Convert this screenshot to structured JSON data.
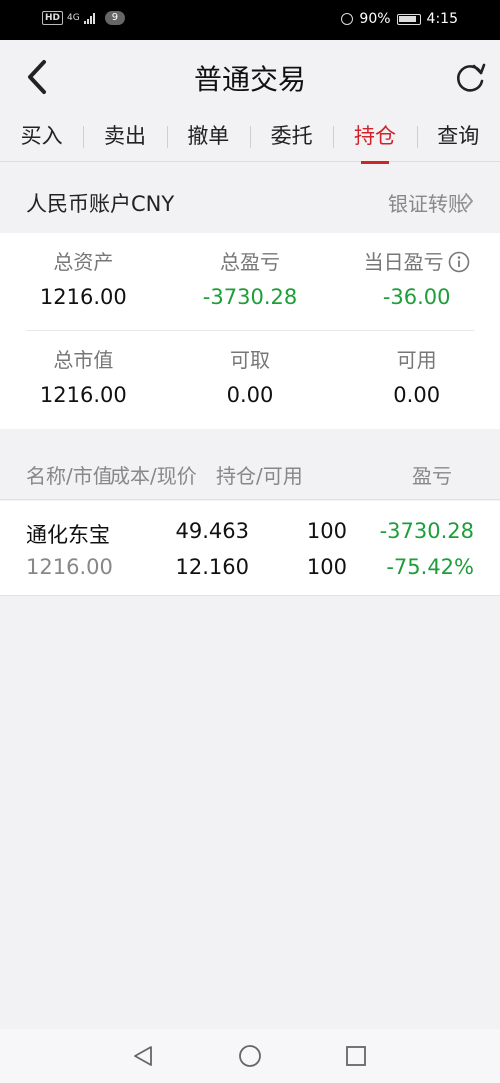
{
  "status_bar": {
    "hd": "HD",
    "network": "4G",
    "notification_count": "9",
    "battery": "90%",
    "time": "4:15"
  },
  "header": {
    "title": "普通交易",
    "back_icon": "chevron-left-icon",
    "refresh_icon": "refresh-icon"
  },
  "tabs": [
    {
      "label": "买入",
      "active": false
    },
    {
      "label": "卖出",
      "active": false
    },
    {
      "label": "撤单",
      "active": false
    },
    {
      "label": "委托",
      "active": false
    },
    {
      "label": "持仓",
      "active": true
    },
    {
      "label": "查询",
      "active": false
    }
  ],
  "account": {
    "name": "人民币账户CNY",
    "transfer_label": "银证转账"
  },
  "summary": {
    "total_assets_label": "总资产",
    "total_assets": "1216.00",
    "total_pl_label": "总盈亏",
    "total_pl": "-3730.28",
    "daily_pl_label": "当日盈亏",
    "daily_pl": "-36.00",
    "market_value_label": "总市值",
    "market_value": "1216.00",
    "withdrawable_label": "可取",
    "withdrawable": "0.00",
    "available_label": "可用",
    "available": "0.00"
  },
  "list_header": {
    "name_mv": "名称/市值",
    "cost_price": "成本/现价",
    "hold_avail": "持仓/可用",
    "pl": "盈亏"
  },
  "positions": [
    {
      "name": "通化东宝",
      "market_value": "1216.00",
      "cost": "49.463",
      "price": "12.160",
      "holding": "100",
      "available": "100",
      "pl": "-3730.28",
      "pl_pct": "-75.42%"
    }
  ],
  "colors": {
    "accent_red": "#d0232b",
    "loss_green": "#1e9e3a",
    "background": "#f2f2f4"
  },
  "nav": {
    "back": "nav-back-icon",
    "home": "nav-home-icon",
    "recents": "nav-recents-icon"
  }
}
